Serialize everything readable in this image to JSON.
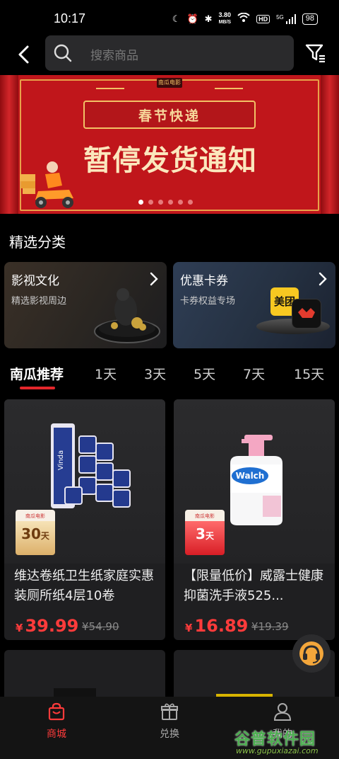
{
  "status_bar": {
    "time": "10:17",
    "net_speed_value": "3.80",
    "net_speed_unit": "MB/S",
    "hd_badge": "HD",
    "signal_label": "5G",
    "battery": "98"
  },
  "search": {
    "placeholder": "搜索商品"
  },
  "banner": {
    "logo": "南瓜电影",
    "subtitle": "春节快递",
    "title": "暂停发货通知",
    "dot_count": 6,
    "active_dot": 0
  },
  "section": {
    "title": "精选分类"
  },
  "categories": [
    {
      "title": "影视文化",
      "desc": "精选影视周边"
    },
    {
      "title": "优惠卡券",
      "desc": "卡券权益专场",
      "brand_badge": "美团"
    }
  ],
  "tabs": [
    {
      "label": "南瓜推荐",
      "active": true
    },
    {
      "label": "1天"
    },
    {
      "label": "3天"
    },
    {
      "label": "5天"
    },
    {
      "label": "7天"
    },
    {
      "label": "15天"
    }
  ],
  "products": [
    {
      "name": "维达卷纸卫生纸家庭实惠装厕所纸4层10卷",
      "currency": "¥",
      "price": "39.99",
      "old_price": "¥54.90",
      "badge_days": "30",
      "badge_unit": "天",
      "brand_text": "Vinda"
    },
    {
      "name": "【限量低价】威露士健康抑菌洗手液525...",
      "currency": "¥",
      "price": "16.89",
      "old_price": "¥19.39",
      "badge_days": "3",
      "badge_unit": "天",
      "brand_text": "Walch"
    }
  ],
  "bottom_nav": [
    {
      "label": "商城",
      "active": true
    },
    {
      "label": "兑换"
    },
    {
      "label": "我的"
    }
  ],
  "watermark": {
    "title": "谷普软件园",
    "url": "www.gupuxiazai.com"
  },
  "colors": {
    "accent_red": "#ff3b3b",
    "banner_red": "#c0161b",
    "background": "#000000",
    "card_bg": "#1f1f21"
  }
}
